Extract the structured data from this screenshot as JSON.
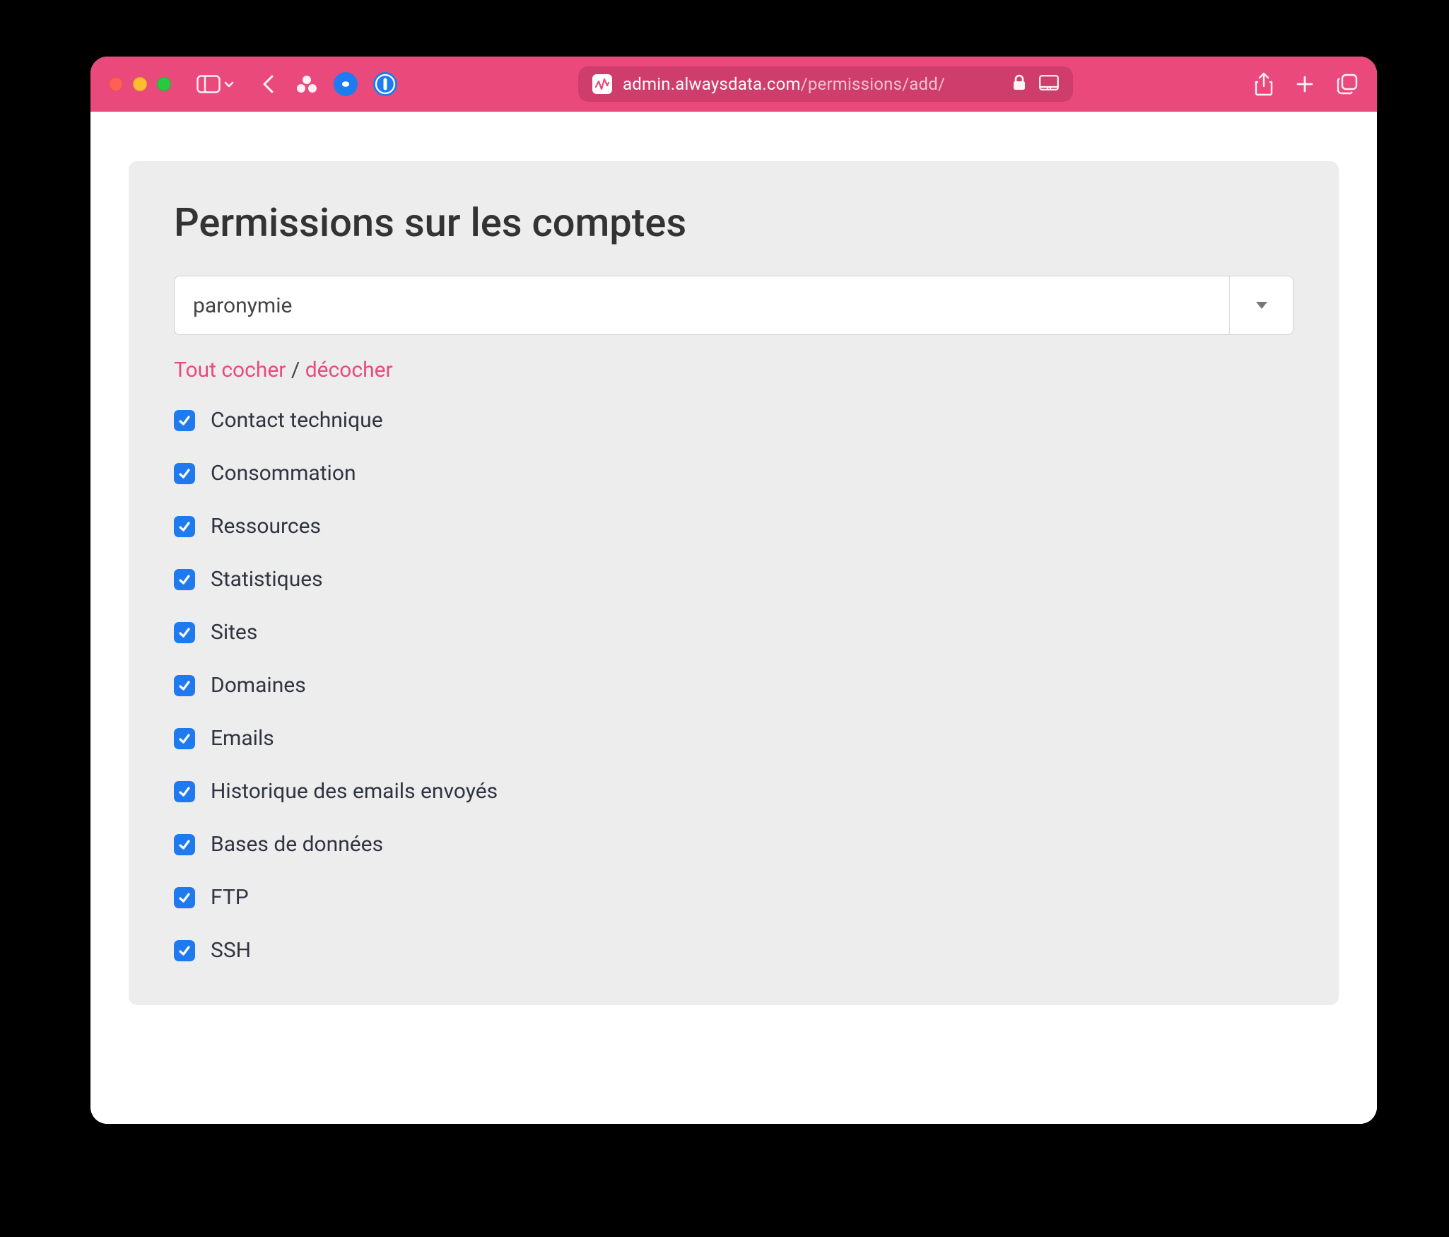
{
  "browser": {
    "url_host": "admin.alwaysdata.com",
    "url_path": "/permissions/add/"
  },
  "page": {
    "title": "Permissions sur les comptes",
    "account_select_value": "paronymie",
    "check_all_label": "Tout cocher",
    "separator": " / ",
    "uncheck_all_label": "décocher",
    "permissions": [
      {
        "label": "Contact technique",
        "checked": true
      },
      {
        "label": "Consommation",
        "checked": true
      },
      {
        "label": "Ressources",
        "checked": true
      },
      {
        "label": "Statistiques",
        "checked": true
      },
      {
        "label": "Sites",
        "checked": true
      },
      {
        "label": "Domaines",
        "checked": true
      },
      {
        "label": "Emails",
        "checked": true
      },
      {
        "label": "Historique des emails envoyés",
        "checked": true
      },
      {
        "label": "Bases de données",
        "checked": true
      },
      {
        "label": "FTP",
        "checked": true
      },
      {
        "label": "SSH",
        "checked": true
      }
    ]
  }
}
